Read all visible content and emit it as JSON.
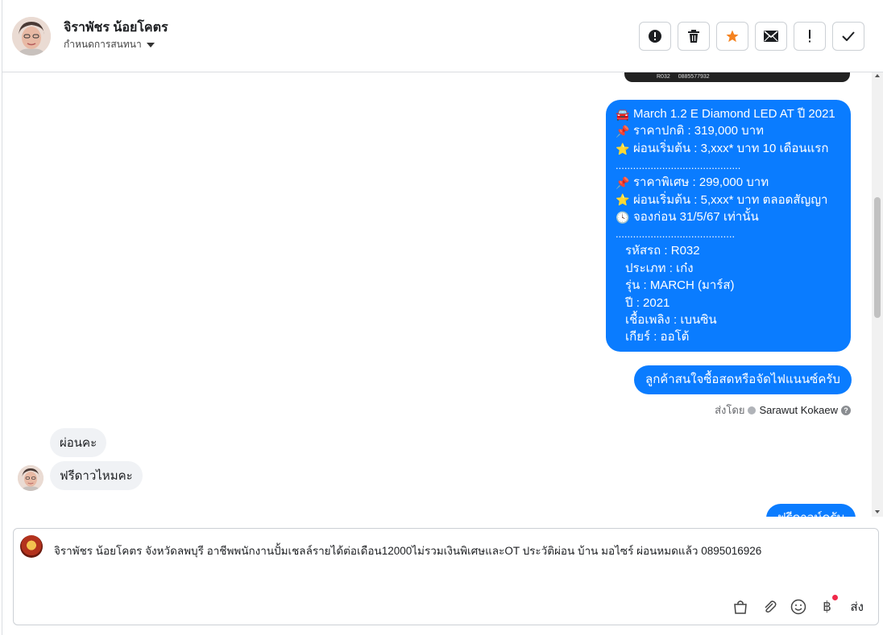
{
  "header": {
    "contact_name": "จิราพัชร น้อยโคตร",
    "assign_label": "กำหนดการสนทนา",
    "actions": [
      {
        "name": "spam-button",
        "icon": "alert-circle-icon"
      },
      {
        "name": "delete-button",
        "icon": "trash-icon"
      },
      {
        "name": "star-button",
        "icon": "star-icon"
      },
      {
        "name": "mark-unread-button",
        "icon": "envelope-icon"
      },
      {
        "name": "important-button",
        "icon": "exclamation-icon"
      },
      {
        "name": "done-button",
        "icon": "check-icon"
      }
    ]
  },
  "image_strip": {
    "code": "R032",
    "phone": "0885577932"
  },
  "outgoing_main": {
    "lines": [
      {
        "emoji": "🚘",
        "text": "March 1.2 E Diamond LED AT ปี 2021"
      },
      {
        "emoji": "📌",
        "text": "ราคาปกติ : 319,000 บาท"
      },
      {
        "emoji": "⭐",
        "text": "ผ่อนเริ่มต้น : 3,xxx* บาท 10 เดือนแรก"
      },
      {
        "emoji": "",
        "text": "..........................................."
      },
      {
        "emoji": "📌",
        "text": "ราคาพิเศษ : 299,000 บาท"
      },
      {
        "emoji": "⭐",
        "text": "ผ่อนเริ่มต้น : 5,xxx* บาท ตลอดสัญญา"
      },
      {
        "emoji": "🕓",
        "text": "จองก่อน 31/5/67 เท่านั้น"
      },
      {
        "emoji": "",
        "text": "........................................."
      },
      {
        "emoji": "",
        "text": "รหัสรถ : R032",
        "indent": true
      },
      {
        "emoji": "",
        "text": "ประเภท : เก๋ง",
        "indent": true
      },
      {
        "emoji": "",
        "text": "รุ่น : MARCH (มาร์ส)",
        "indent": true
      },
      {
        "emoji": "",
        "text": "ปี : 2021",
        "indent": true
      },
      {
        "emoji": "",
        "text": "เชื้อเพลิง : เบนซิน",
        "indent": true
      },
      {
        "emoji": "",
        "text": "เกียร์ : ออโต้",
        "indent": true
      }
    ]
  },
  "outgoing_short": "ลูกค้าสนใจซื้อสดหรือจัดไฟแนนซ์ครับ",
  "sent_by": {
    "prefix": "ส่งโดย",
    "name": "Sarawut Kokaew",
    "help": "?"
  },
  "incoming": [
    "ผ่อนคะ",
    "ฟรีดาวไหมคะ"
  ],
  "outgoing_cut": "ฟรีดาวน์ครับ",
  "composer": {
    "text": "จิราพัชร น้อยโคตร จังหวัดลพบุรี อาชีพพนักงานปั้มเชลล์รายได้ต่อเดือน12000ไม่รวมเงินพิเศษและOT ประวัติผ่อน บ้าน มอไซร์ ผ่อนหมดแล้ว 0895016926",
    "baht_symbol": "฿",
    "send_label": "ส่ง"
  },
  "colors": {
    "outgoing_bubble": "#0a7cff",
    "incoming_bubble": "#f0f2f5",
    "star": "#f5821f",
    "notification_dot": "#f02849"
  }
}
